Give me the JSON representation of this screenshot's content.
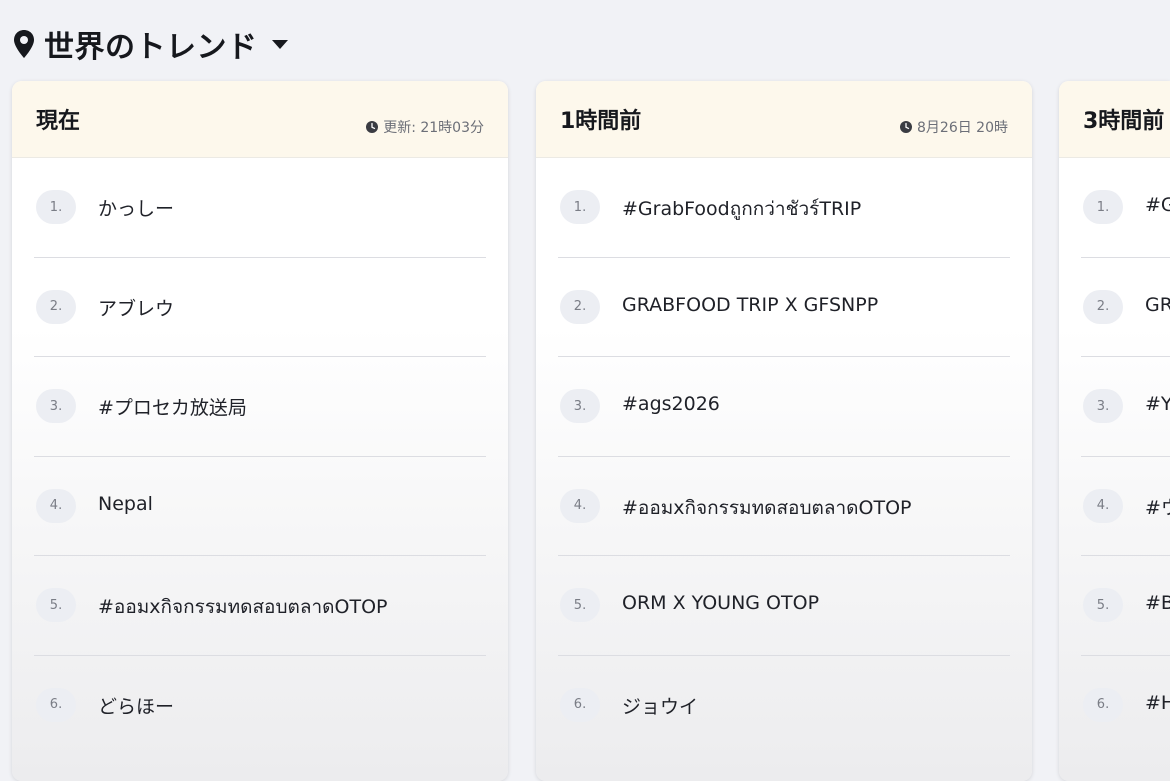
{
  "header": {
    "title": "世界のトレンド",
    "location_icon": "map-pin-icon",
    "dropdown_icon": "caret-down-icon"
  },
  "columns": [
    {
      "title": "現在",
      "updated": "更新: 21時03分",
      "trends": [
        {
          "rank": "1.",
          "name": "かっしー"
        },
        {
          "rank": "2.",
          "name": "アブレウ"
        },
        {
          "rank": "3.",
          "name": "#プロセカ放送局"
        },
        {
          "rank": "4.",
          "name": "Nepal"
        },
        {
          "rank": "5.",
          "name": "#ออมxกิจกรรมทดสอบตลาดOTOP"
        },
        {
          "rank": "6.",
          "name": "どらほー"
        }
      ]
    },
    {
      "title": "1時間前",
      "updated": "8月26日 20時",
      "trends": [
        {
          "rank": "1.",
          "name": "#GrabFoodถูกกว่าชัวร์TRIP"
        },
        {
          "rank": "2.",
          "name": "GRABFOOD TRIP X GFSNPP"
        },
        {
          "rank": "3.",
          "name": "#ags2026"
        },
        {
          "rank": "4.",
          "name": "#ออมxกิจกรรมทดสอบตลาดOTOP"
        },
        {
          "rank": "5.",
          "name": "ORM X YOUNG OTOP"
        },
        {
          "rank": "6.",
          "name": "ジョウイ"
        }
      ]
    },
    {
      "title": "3時間前",
      "updated": "",
      "trends": [
        {
          "rank": "1.",
          "name": "#G"
        },
        {
          "rank": "2.",
          "name": "GR"
        },
        {
          "rank": "3.",
          "name": "#Y"
        },
        {
          "rank": "4.",
          "name": "#ウ"
        },
        {
          "rank": "5.",
          "name": "#B"
        },
        {
          "rank": "6.",
          "name": "#H"
        }
      ]
    }
  ],
  "colors": {
    "page_background": "#f1f2f6",
    "column_header_background": "#fdf8ec",
    "rank_badge_background": "#eceef3",
    "text": "#1f2128",
    "muted_text": "#6c6f78"
  }
}
